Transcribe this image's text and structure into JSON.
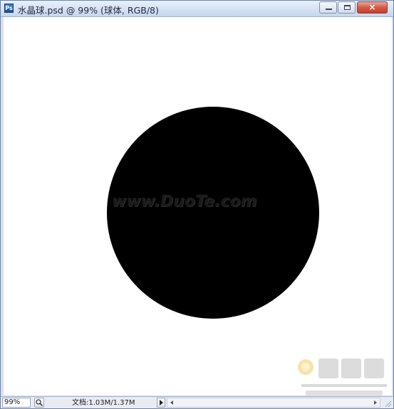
{
  "window": {
    "title": "水晶球.psd @ 99% (球体, RGB/8)",
    "icon": "photoshop-document-icon",
    "icon_glyph": "Ps",
    "controls": {
      "minimize_icon": "minimize-icon",
      "maximize_icon": "maximize-icon",
      "close_icon": "close-icon",
      "close_glyph": "×"
    }
  },
  "canvas": {
    "background": "#ffffff",
    "shape": "black-circle",
    "shape_color": "#000000",
    "watermark_text": "www.DuoTe.com",
    "corner_logo": "jzxue-site-logo"
  },
  "statusbar": {
    "zoom": "99%",
    "document_info": "文档:1.03M/1.37M",
    "zoom_icon": "zoom-icon",
    "menu_icon": "right-arrow-icon",
    "scroll_left_icon": "scroll-left-icon",
    "scroll_right_icon": "scroll-right-icon"
  },
  "colors": {
    "title_bar": "#d6e2f3",
    "close_button": "#c2412d",
    "status_bar": "#e8ecf2"
  }
}
